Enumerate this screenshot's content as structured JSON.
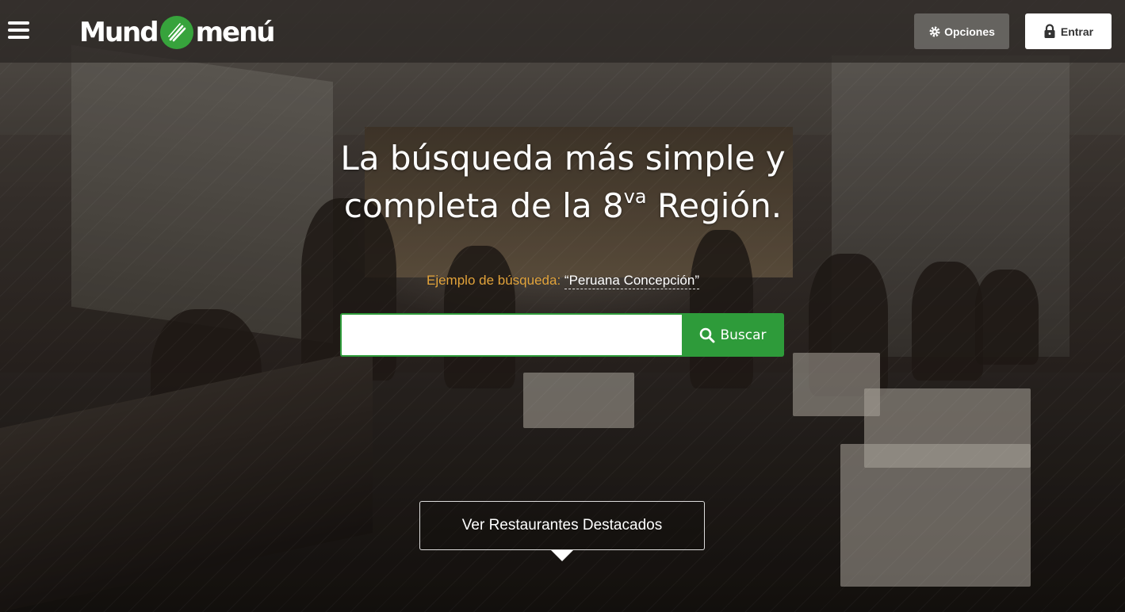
{
  "header": {
    "logo": {
      "text_left": "Mund",
      "text_right": "menú",
      "icon": "fork-knife-icon",
      "brand_color": "#37a33c"
    },
    "menu_icon": "hamburger-icon",
    "options_button": {
      "label": "Opciones",
      "icon": "gear-icon"
    },
    "login_button": {
      "label": "Entrar",
      "icon": "lock-icon"
    }
  },
  "hero": {
    "headline_line1": "La búsqueda más simple y",
    "headline_line2_pre": "completa de la 8",
    "headline_line2_sup": "va",
    "headline_line2_post": " Región.",
    "example_label": "Ejemplo de búsqueda:",
    "example_value": "“Peruana Concepción”",
    "accent_color": "#e2a33a"
  },
  "search": {
    "value": "",
    "button_label": "Buscar",
    "button_icon": "search-icon",
    "button_color": "#2e9b3a"
  },
  "featured": {
    "label": "Ver Restaurantes Destacados",
    "icon": "caret-down-icon"
  }
}
